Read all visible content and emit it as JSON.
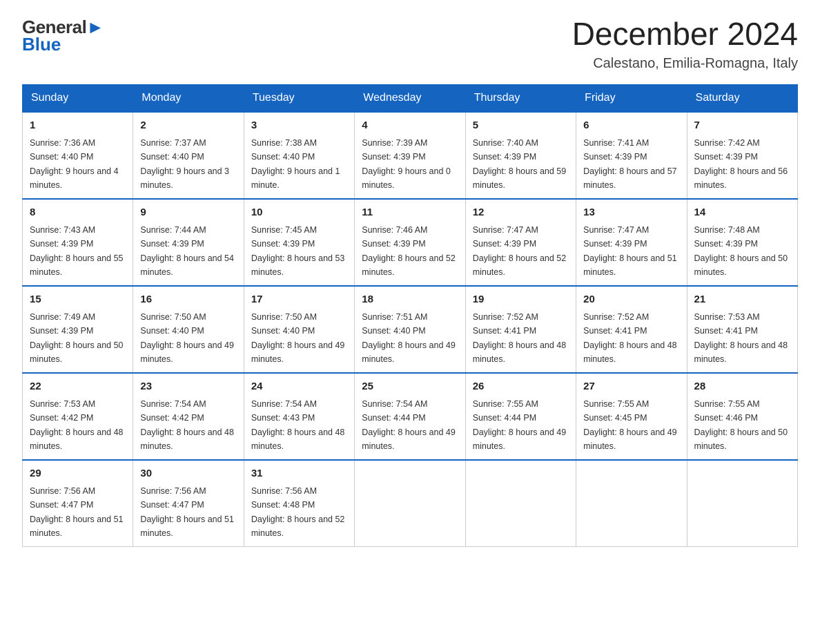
{
  "logo": {
    "general": "General",
    "blue": "Blue",
    "arrow": "▼"
  },
  "title": "December 2024",
  "location": "Calestano, Emilia-Romagna, Italy",
  "days_of_week": [
    "Sunday",
    "Monday",
    "Tuesday",
    "Wednesday",
    "Thursday",
    "Friday",
    "Saturday"
  ],
  "weeks": [
    [
      {
        "day": "1",
        "sunrise": "7:36 AM",
        "sunset": "4:40 PM",
        "daylight": "9 hours and 4 minutes."
      },
      {
        "day": "2",
        "sunrise": "7:37 AM",
        "sunset": "4:40 PM",
        "daylight": "9 hours and 3 minutes."
      },
      {
        "day": "3",
        "sunrise": "7:38 AM",
        "sunset": "4:40 PM",
        "daylight": "9 hours and 1 minute."
      },
      {
        "day": "4",
        "sunrise": "7:39 AM",
        "sunset": "4:39 PM",
        "daylight": "9 hours and 0 minutes."
      },
      {
        "day": "5",
        "sunrise": "7:40 AM",
        "sunset": "4:39 PM",
        "daylight": "8 hours and 59 minutes."
      },
      {
        "day": "6",
        "sunrise": "7:41 AM",
        "sunset": "4:39 PM",
        "daylight": "8 hours and 57 minutes."
      },
      {
        "day": "7",
        "sunrise": "7:42 AM",
        "sunset": "4:39 PM",
        "daylight": "8 hours and 56 minutes."
      }
    ],
    [
      {
        "day": "8",
        "sunrise": "7:43 AM",
        "sunset": "4:39 PM",
        "daylight": "8 hours and 55 minutes."
      },
      {
        "day": "9",
        "sunrise": "7:44 AM",
        "sunset": "4:39 PM",
        "daylight": "8 hours and 54 minutes."
      },
      {
        "day": "10",
        "sunrise": "7:45 AM",
        "sunset": "4:39 PM",
        "daylight": "8 hours and 53 minutes."
      },
      {
        "day": "11",
        "sunrise": "7:46 AM",
        "sunset": "4:39 PM",
        "daylight": "8 hours and 52 minutes."
      },
      {
        "day": "12",
        "sunrise": "7:47 AM",
        "sunset": "4:39 PM",
        "daylight": "8 hours and 52 minutes."
      },
      {
        "day": "13",
        "sunrise": "7:47 AM",
        "sunset": "4:39 PM",
        "daylight": "8 hours and 51 minutes."
      },
      {
        "day": "14",
        "sunrise": "7:48 AM",
        "sunset": "4:39 PM",
        "daylight": "8 hours and 50 minutes."
      }
    ],
    [
      {
        "day": "15",
        "sunrise": "7:49 AM",
        "sunset": "4:39 PM",
        "daylight": "8 hours and 50 minutes."
      },
      {
        "day": "16",
        "sunrise": "7:50 AM",
        "sunset": "4:40 PM",
        "daylight": "8 hours and 49 minutes."
      },
      {
        "day": "17",
        "sunrise": "7:50 AM",
        "sunset": "4:40 PM",
        "daylight": "8 hours and 49 minutes."
      },
      {
        "day": "18",
        "sunrise": "7:51 AM",
        "sunset": "4:40 PM",
        "daylight": "8 hours and 49 minutes."
      },
      {
        "day": "19",
        "sunrise": "7:52 AM",
        "sunset": "4:41 PM",
        "daylight": "8 hours and 48 minutes."
      },
      {
        "day": "20",
        "sunrise": "7:52 AM",
        "sunset": "4:41 PM",
        "daylight": "8 hours and 48 minutes."
      },
      {
        "day": "21",
        "sunrise": "7:53 AM",
        "sunset": "4:41 PM",
        "daylight": "8 hours and 48 minutes."
      }
    ],
    [
      {
        "day": "22",
        "sunrise": "7:53 AM",
        "sunset": "4:42 PM",
        "daylight": "8 hours and 48 minutes."
      },
      {
        "day": "23",
        "sunrise": "7:54 AM",
        "sunset": "4:42 PM",
        "daylight": "8 hours and 48 minutes."
      },
      {
        "day": "24",
        "sunrise": "7:54 AM",
        "sunset": "4:43 PM",
        "daylight": "8 hours and 48 minutes."
      },
      {
        "day": "25",
        "sunrise": "7:54 AM",
        "sunset": "4:44 PM",
        "daylight": "8 hours and 49 minutes."
      },
      {
        "day": "26",
        "sunrise": "7:55 AM",
        "sunset": "4:44 PM",
        "daylight": "8 hours and 49 minutes."
      },
      {
        "day": "27",
        "sunrise": "7:55 AM",
        "sunset": "4:45 PM",
        "daylight": "8 hours and 49 minutes."
      },
      {
        "day": "28",
        "sunrise": "7:55 AM",
        "sunset": "4:46 PM",
        "daylight": "8 hours and 50 minutes."
      }
    ],
    [
      {
        "day": "29",
        "sunrise": "7:56 AM",
        "sunset": "4:47 PM",
        "daylight": "8 hours and 51 minutes."
      },
      {
        "day": "30",
        "sunrise": "7:56 AM",
        "sunset": "4:47 PM",
        "daylight": "8 hours and 51 minutes."
      },
      {
        "day": "31",
        "sunrise": "7:56 AM",
        "sunset": "4:48 PM",
        "daylight": "8 hours and 52 minutes."
      },
      null,
      null,
      null,
      null
    ]
  ]
}
